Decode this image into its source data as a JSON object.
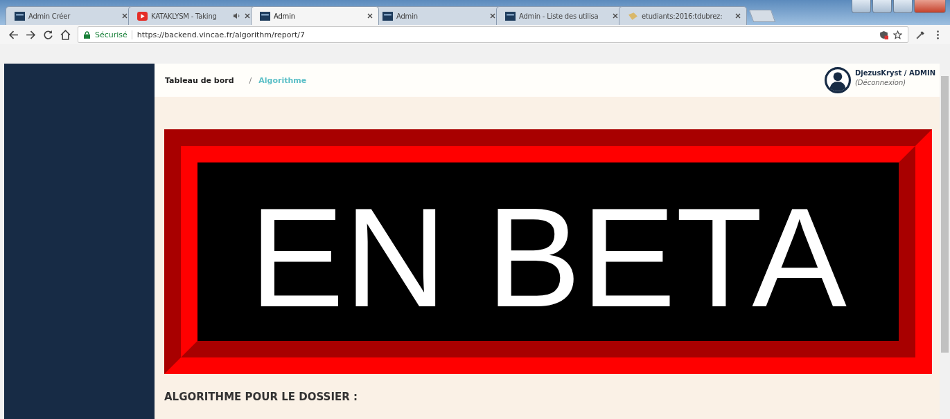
{
  "tabs": [
    {
      "title": "Admin Créer",
      "kind": "app",
      "audio": false,
      "selected": false
    },
    {
      "title": "KATAKLYSM - Taking",
      "kind": "video",
      "audio": true,
      "selected": false
    },
    {
      "title": "Admin",
      "kind": "app",
      "audio": false,
      "selected": true
    },
    {
      "title": "Admin",
      "kind": "app",
      "audio": false,
      "selected": false
    },
    {
      "title": "Admin - Liste des utilisa",
      "kind": "app",
      "audio": false,
      "selected": false
    },
    {
      "title": "etudiants:2016:tdubrez:",
      "kind": "doc",
      "audio": false,
      "selected": false
    }
  ],
  "address_bar": {
    "security": "Sécurisé",
    "url": "https://backend.vincae.fr/algorithm/report/7"
  },
  "breadcrumb": [
    {
      "label": "Tableau de bord",
      "selected": false
    },
    {
      "separator": "/",
      "label": "Algorithme",
      "selected": true
    }
  ],
  "user": {
    "name": "DjezusKryst / ADMIN",
    "logout": "(Déconnexion)"
  },
  "banner": {
    "text": "EN BETA"
  },
  "section_title": "ALGORITHME POUR LE DOSSIER :"
}
